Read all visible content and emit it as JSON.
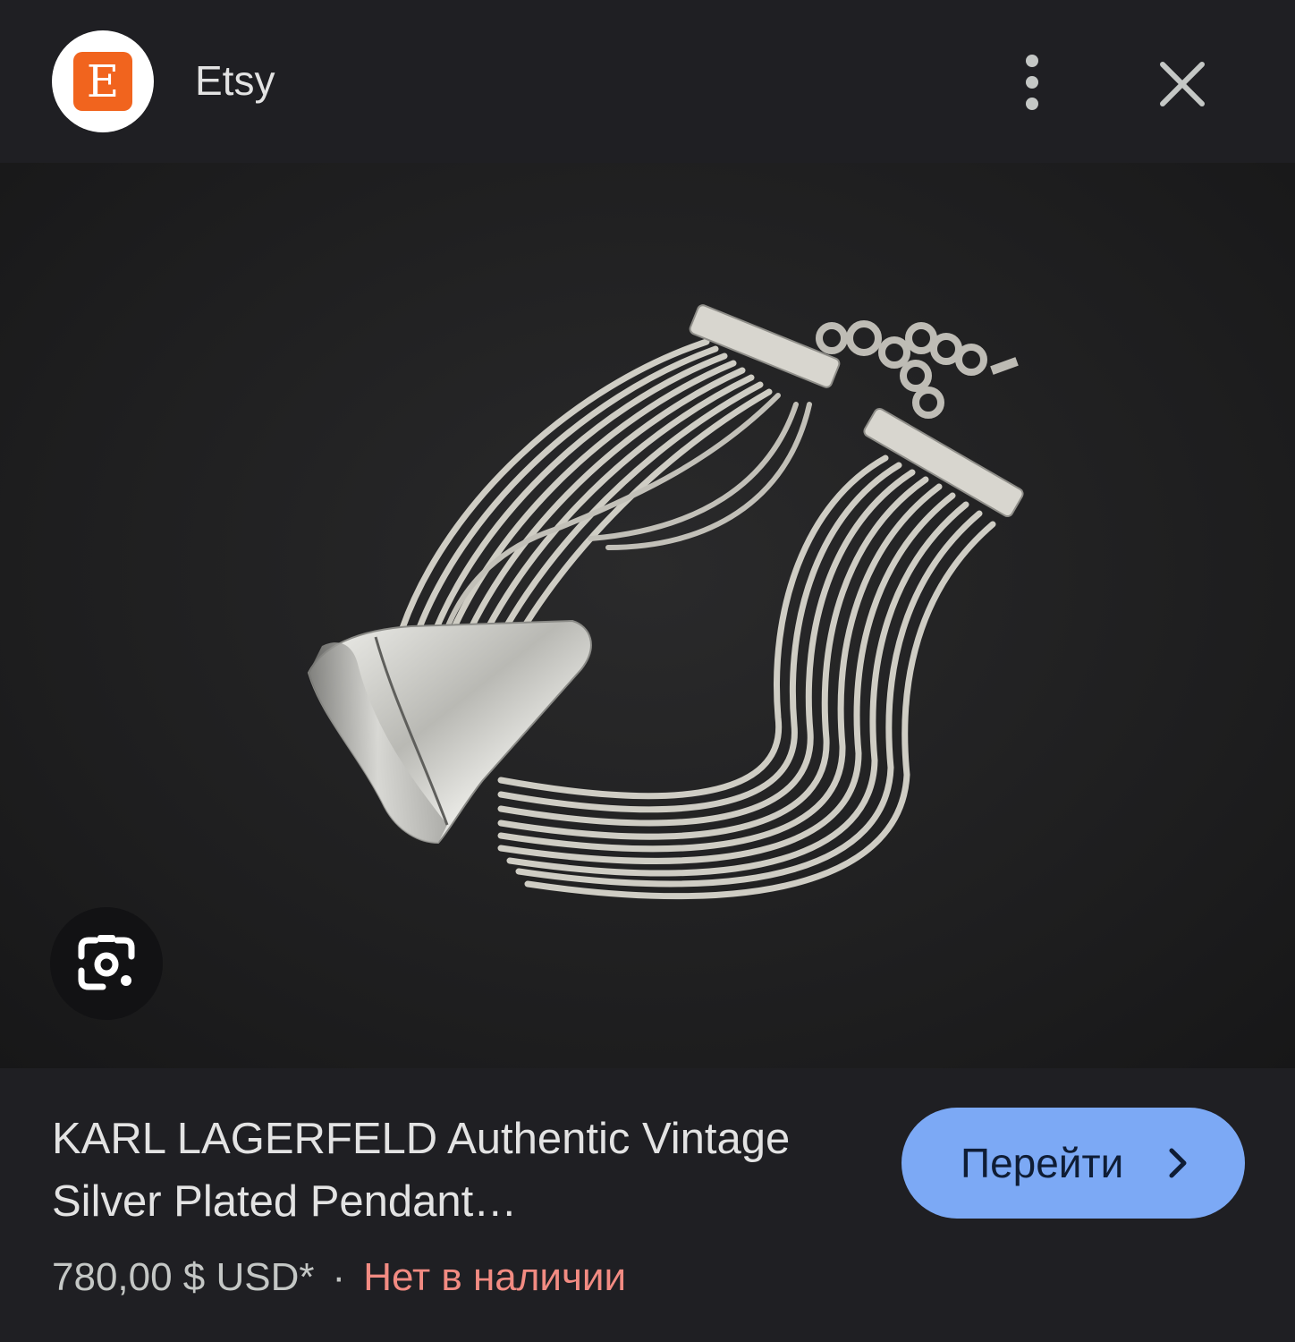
{
  "header": {
    "logo_letter": "E",
    "site_name": "Etsy"
  },
  "colors": {
    "background": "#1f1f23",
    "brand_orange": "#f1641e",
    "button_blue": "#7ca9f5",
    "out_of_stock_red": "#f28b82"
  },
  "icons": {
    "menu": "more-vert-icon",
    "close": "close-icon",
    "lens": "google-lens-icon",
    "go": "chevron-right-icon"
  },
  "product": {
    "title": "KARL LAGERFELD Authentic Vintage Silver Plated Pendant…",
    "price": "780,00 $ USD*",
    "separator": "·",
    "availability": "Нет в наличии"
  },
  "actions": {
    "go_label": "Перейти"
  }
}
